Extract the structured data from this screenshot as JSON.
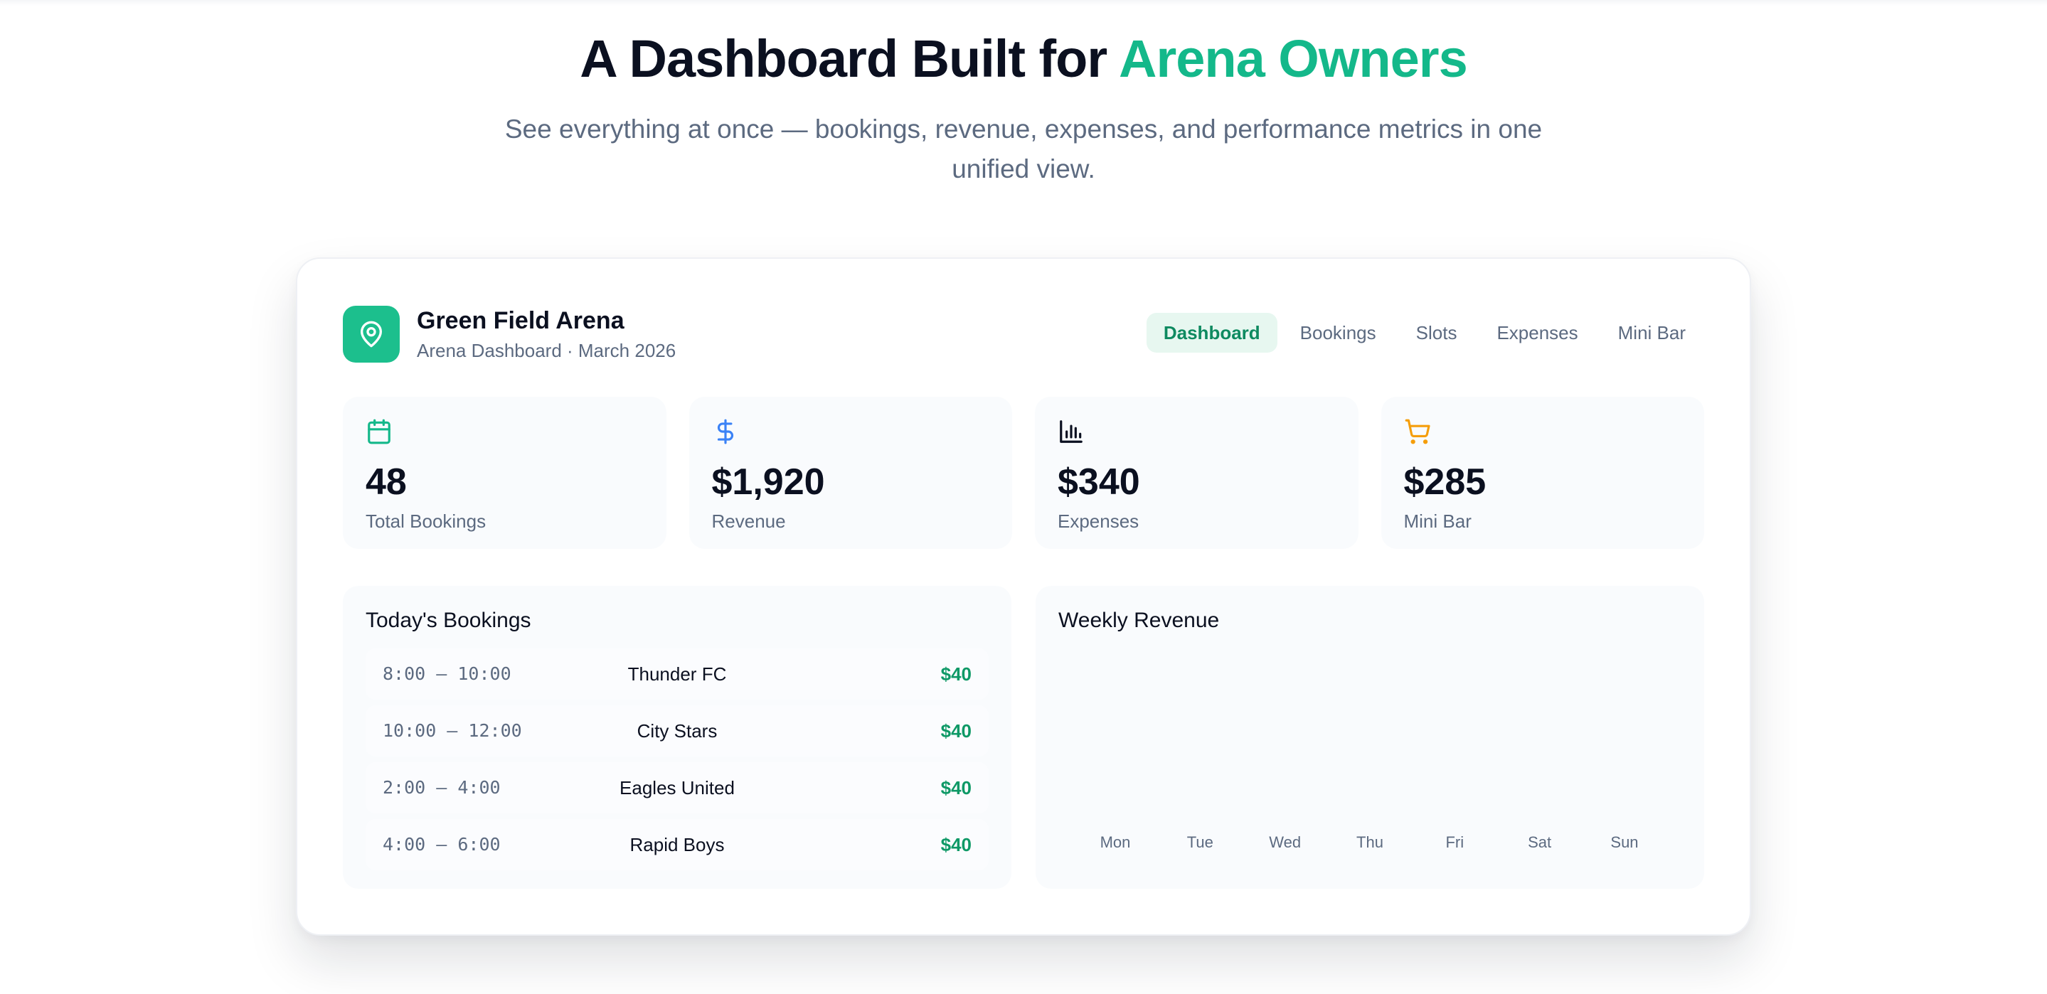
{
  "hero": {
    "title_main": "A Dashboard Built for ",
    "title_accent": "Arena Owners",
    "subtitle": "See everything at once — bookings, revenue, expenses, and performance metrics in one unified view."
  },
  "brand": {
    "name": "Green Field Arena",
    "subtitle": "Arena Dashboard · March 2026",
    "icon": "map-pin-icon"
  },
  "nav": {
    "items": [
      {
        "label": "Dashboard",
        "active": true
      },
      {
        "label": "Bookings",
        "active": false
      },
      {
        "label": "Slots",
        "active": false
      },
      {
        "label": "Expenses",
        "active": false
      },
      {
        "label": "Mini Bar",
        "active": false
      }
    ]
  },
  "stats": [
    {
      "icon": "calendar-icon",
      "value": "48",
      "label": "Total Bookings",
      "color": "#14b88a"
    },
    {
      "icon": "dollar-icon",
      "value": "$1,920",
      "label": "Revenue",
      "color": "#3b82f6"
    },
    {
      "icon": "bar-chart-icon",
      "value": "$340",
      "label": "Expenses",
      "color": "#0b1020"
    },
    {
      "icon": "cart-icon",
      "value": "$285",
      "label": "Mini Bar",
      "color": "#f59e0b"
    }
  ],
  "bookings": {
    "title": "Today's Bookings",
    "rows": [
      {
        "time": "8:00 – 10:00",
        "team": "Thunder FC",
        "price": "$40"
      },
      {
        "time": "10:00 – 12:00",
        "team": "City Stars",
        "price": "$40"
      },
      {
        "time": "2:00 – 4:00",
        "team": "Eagles United",
        "price": "$40"
      },
      {
        "time": "4:00 – 6:00",
        "team": "Rapid Boys",
        "price": "$40"
      }
    ]
  },
  "revenue": {
    "title": "Weekly Revenue",
    "days": [
      "Mon",
      "Tue",
      "Wed",
      "Thu",
      "Fri",
      "Sat",
      "Sun"
    ]
  },
  "colors": {
    "accent": "#14b88a",
    "accent_dark": "#0e8a60",
    "price": "#0e9966",
    "muted_text": "#5c6a80"
  }
}
